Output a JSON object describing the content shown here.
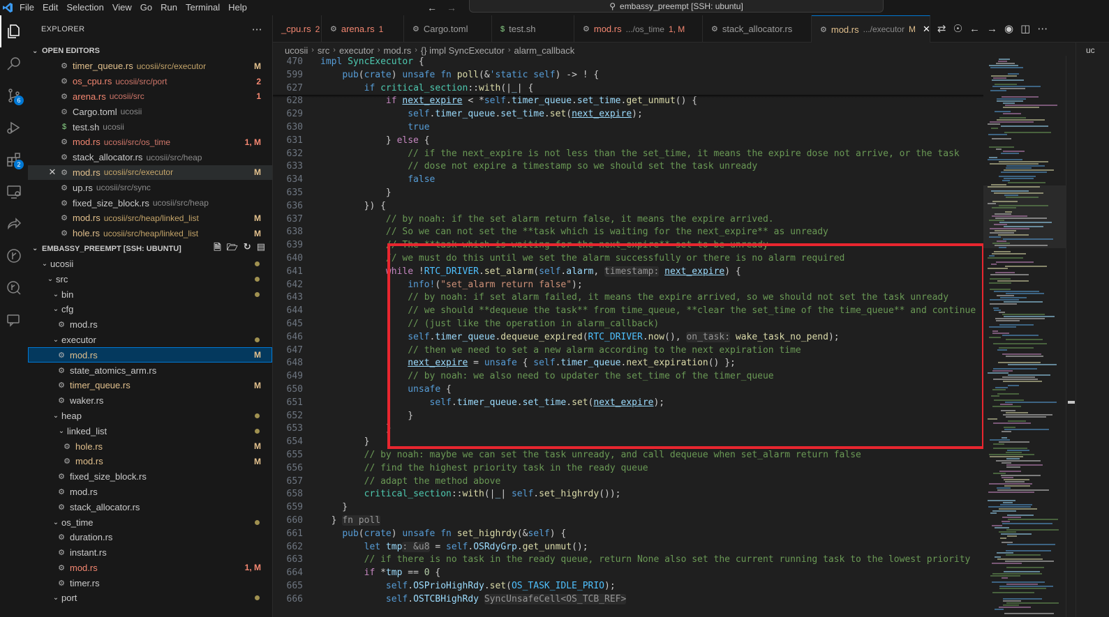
{
  "menu": [
    "File",
    "Edit",
    "Selection",
    "View",
    "Go",
    "Run",
    "Terminal",
    "Help"
  ],
  "command_center": "embassy_preempt [SSH: ubuntu]",
  "activity": {
    "scm_badge": "6",
    "extensions_badge": "2"
  },
  "explorer": {
    "title": "EXPLORER",
    "open_editors_label": "OPEN EDITORS",
    "open_editors": [
      {
        "name": "timer_queue.rs",
        "path": "ucosii/src/executor",
        "badge": "M",
        "status": "m"
      },
      {
        "name": "os_cpu.rs",
        "path": "ucosii/src/port",
        "badge": "2",
        "status": "err"
      },
      {
        "name": "arena.rs",
        "path": "ucosii/src",
        "badge": "1",
        "status": "err"
      },
      {
        "name": "Cargo.toml",
        "path": "ucosii",
        "badge": "",
        "status": ""
      },
      {
        "name": "test.sh",
        "path": "ucosii",
        "badge": "",
        "status": ""
      },
      {
        "name": "mod.rs",
        "path": "ucosii/src/os_time",
        "badge": "1, M",
        "status": "err"
      },
      {
        "name": "stack_allocator.rs",
        "path": "ucosii/src/heap",
        "badge": "",
        "status": ""
      },
      {
        "name": "mod.rs",
        "path": "ucosii/src/executor",
        "badge": "M",
        "status": "m"
      },
      {
        "name": "up.rs",
        "path": "ucosii/src/sync",
        "badge": "",
        "status": ""
      },
      {
        "name": "fixed_size_block.rs",
        "path": "ucosii/src/heap",
        "badge": "",
        "status": ""
      },
      {
        "name": "mod.rs",
        "path": "ucosii/src/heap/linked_list",
        "badge": "M",
        "status": "m"
      },
      {
        "name": "hole.rs",
        "path": "ucosii/src/heap/linked_list",
        "badge": "M",
        "status": "m"
      }
    ],
    "workspace_label": "EMBASSY_PREEMPT [SSH: UBUNTU]",
    "tree": [
      {
        "name": "ucosii",
        "type": "folder",
        "open": true,
        "depth": 0,
        "dot": true
      },
      {
        "name": "src",
        "type": "folder",
        "open": true,
        "depth": 1,
        "dot": true
      },
      {
        "name": "bin",
        "type": "folder",
        "open": true,
        "depth": 2,
        "dot": true
      },
      {
        "name": "cfg",
        "type": "folder",
        "open": true,
        "depth": 2
      },
      {
        "name": "mod.rs",
        "type": "file",
        "depth": 3
      },
      {
        "name": "executor",
        "type": "folder",
        "open": true,
        "depth": 2,
        "dot": true
      },
      {
        "name": "mod.rs",
        "type": "file",
        "depth": 3,
        "badge": "M",
        "status": "m",
        "selected": true
      },
      {
        "name": "state_atomics_arm.rs",
        "type": "file",
        "depth": 3
      },
      {
        "name": "timer_queue.rs",
        "type": "file",
        "depth": 3,
        "badge": "M",
        "status": "m"
      },
      {
        "name": "waker.rs",
        "type": "file",
        "depth": 3
      },
      {
        "name": "heap",
        "type": "folder",
        "open": true,
        "depth": 2,
        "dot": true
      },
      {
        "name": "linked_list",
        "type": "folder",
        "open": true,
        "depth": 3,
        "dot": true
      },
      {
        "name": "hole.rs",
        "type": "file",
        "depth": 4,
        "badge": "M",
        "status": "m"
      },
      {
        "name": "mod.rs",
        "type": "file",
        "depth": 4,
        "badge": "M",
        "status": "m"
      },
      {
        "name": "fixed_size_block.rs",
        "type": "file",
        "depth": 3
      },
      {
        "name": "mod.rs",
        "type": "file",
        "depth": 3
      },
      {
        "name": "stack_allocator.rs",
        "type": "file",
        "depth": 3
      },
      {
        "name": "os_time",
        "type": "folder",
        "open": true,
        "depth": 2,
        "dot": true
      },
      {
        "name": "duration.rs",
        "type": "file",
        "depth": 3
      },
      {
        "name": "instant.rs",
        "type": "file",
        "depth": 3
      },
      {
        "name": "mod.rs",
        "type": "file",
        "depth": 3,
        "badge": "1, M",
        "status": "err"
      },
      {
        "name": "timer.rs",
        "type": "file",
        "depth": 3
      },
      {
        "name": "port",
        "type": "folder",
        "open": true,
        "depth": 2,
        "dot": true
      }
    ]
  },
  "tabs": [
    {
      "label": "_cpu.rs",
      "desc": "",
      "badge": "2",
      "status": "err",
      "icon": "rust-icon"
    },
    {
      "label": "arena.rs",
      "desc": "",
      "badge": "1",
      "status": "err",
      "icon": "rust-icon"
    },
    {
      "label": "Cargo.toml",
      "desc": "",
      "badge": "",
      "status": "",
      "icon": "gear-icon"
    },
    {
      "label": "test.sh",
      "desc": "",
      "badge": "",
      "status": "",
      "icon": "dollar-icon"
    },
    {
      "label": "mod.rs",
      "desc": ".../os_time",
      "badge": "1, M",
      "status": "err",
      "icon": "rust-icon"
    },
    {
      "label": "stack_allocator.rs",
      "desc": "",
      "badge": "",
      "status": "",
      "icon": "rust-icon"
    },
    {
      "label": "mod.rs",
      "desc": ".../executor",
      "badge": "M",
      "status": "m",
      "icon": "rust-icon",
      "active": true
    }
  ],
  "breadcrumb": [
    "ucosii",
    "src",
    "executor",
    "mod.rs",
    "{} impl SyncExecutor",
    "alarm_callback"
  ],
  "right_panel_label": "uc",
  "code_lines": [
    {
      "n": "470",
      "sticky": true,
      "html": "<span class='kw'>impl</span> <span class='ty'>SyncExecutor</span> {"
    },
    {
      "n": "599",
      "sticky": true,
      "html": "    <span class='kw'>pub</span>(<span class='kw'>crate</span>) <span class='kw'>unsafe</span> <span class='kw'>fn</span> <span class='fn'>poll</span>(&amp;<span class='kw'>'static</span> <span class='kw'>self</span>) -&gt; ! {"
    },
    {
      "n": "627",
      "html": "        <span class='kw'>if</span> <span class='ty'>critical_section</span>::<span class='fn'>with</span>(|<span class='var'>_</span>| {"
    },
    {
      "n": "628",
      "html": "            <span class='ct'>if</span> <span class='var ul'>next_expire</span> &lt; *<span class='kw'>self</span>.<span class='var'>timer_queue</span>.<span class='var'>set_time</span>.<span class='fn'>get_unmut</span>() {"
    },
    {
      "n": "629",
      "html": "                <span class='kw'>self</span>.<span class='var'>timer_queue</span>.<span class='var'>set_time</span>.<span class='fn'>set</span>(<span class='var ul'>next_expire</span>);"
    },
    {
      "n": "630",
      "html": "                <span class='kw'>true</span>"
    },
    {
      "n": "631",
      "html": "            } <span class='ct'>else</span> {"
    },
    {
      "n": "632",
      "html": "                <span class='cmt'>// if the next_expire is not less than the set_time, it means the expire dose not arrive, or the task</span>"
    },
    {
      "n": "633",
      "html": "                <span class='cmt'>// dose not expire a timestamp so we should set the task unready</span>"
    },
    {
      "n": "634",
      "html": "                <span class='kw'>false</span>"
    },
    {
      "n": "635",
      "html": "            }"
    },
    {
      "n": "636",
      "html": "        }) {"
    },
    {
      "n": "637",
      "html": "            <span class='cmt'>// by noah: if the set alarm return false, it means the expire arrived.</span>"
    },
    {
      "n": "638",
      "html": "            <span class='cmt'>// So we can not set the **task which is waiting for the next_expire** as unready</span>"
    },
    {
      "n": "639",
      "html": "            <span class='cmt'>// The **task which is waiting for the next_expire** set to be unready</span>"
    },
    {
      "n": "640",
      "html": "            <span class='cmt'>// we must do this until we set the alarm successfully or there is no alarm required</span>"
    },
    {
      "n": "641",
      "html": "            <span class='ct'>while</span> !<span class='const'>RTC_DRIVER</span>.<span class='fn'>set_alarm</span>(<span class='kw'>self</span>.<span class='var'>alarm</span>, <span class='hint'>timestamp:</span> <span class='var ul'>next_expire</span>) {"
    },
    {
      "n": "642",
      "html": "                <span class='mac'>info!</span>(<span class='str'>\"set_alarm return false\"</span>);"
    },
    {
      "n": "643",
      "html": "                <span class='cmt'>// by noah: if set alarm failed, it means the expire arrived, so we should not set the task unready</span>"
    },
    {
      "n": "644",
      "html": "                <span class='cmt'>// we should **dequeue the task** from time_queue, **clear the set_time of the time_queue** and continue</span>"
    },
    {
      "n": "645",
      "html": "                <span class='cmt'>// (just like the operation in alarm_callback)</span>"
    },
    {
      "n": "646",
      "html": "                <span class='kw'>self</span>.<span class='var'>timer_queue</span>.<span class='fn'>dequeue_expired</span>(<span class='const'>RTC_DRIVER</span>.<span class='fn'>now</span>(), <span class='hint'>on_task:</span> <span class='fn'>wake_task_no_pend</span>);"
    },
    {
      "n": "647",
      "html": "                <span class='cmt'>// then we need to set a new alarm according to the next expiration time</span>"
    },
    {
      "n": "648",
      "html": "                <span class='var ul'>next_expire</span> = <span class='kw'>unsafe</span> { <span class='kw'>self</span>.<span class='var'>timer_queue</span>.<span class='fn'>next_expiration</span>() };"
    },
    {
      "n": "649",
      "html": "                <span class='cmt'>// by noah: we also need to updater the set_time of the timer_queue</span>"
    },
    {
      "n": "650",
      "html": "                <span class='kw'>unsafe</span> {"
    },
    {
      "n": "651",
      "html": "                    <span class='kw'>self</span>.<span class='var'>timer_queue</span>.<span class='var'>set_time</span>.<span class='fn'>set</span>(<span class='var ul'>next_expire</span>);"
    },
    {
      "n": "652",
      "html": "                }"
    },
    {
      "n": "653",
      "html": "            }"
    },
    {
      "n": "654",
      "html": "        }"
    },
    {
      "n": "655",
      "html": "        <span class='cmt'>// by noah: maybe we can set the task unready, and call dequeue when set_alarm return false</span>"
    },
    {
      "n": "656",
      "html": "        <span class='cmt'>// find the highest priority task in the ready queue</span>"
    },
    {
      "n": "657",
      "html": "        <span class='cmt'>// adapt the method above</span>"
    },
    {
      "n": "658",
      "html": "        <span class='ty'>critical_section</span>::<span class='fn'>with</span>(|<span class='var'>_</span>| <span class='kw'>self</span>.<span class='fn'>set_highrdy</span>());"
    },
    {
      "n": "659",
      "html": "    }"
    },
    {
      "n": "660",
      "html": "  } <span class='hint'>fn poll</span>"
    },
    {
      "n": "661",
      "html": "    <span class='kw'>pub</span>(<span class='kw'>crate</span>) <span class='kw'>unsafe</span> <span class='kw'>fn</span> <span class='fn'>set_highrdy</span>(&amp;<span class='kw'>self</span>) {"
    },
    {
      "n": "662",
      "html": "        <span class='kw'>let</span> <span class='var'>tmp</span><span class='hint'>: &amp;u8</span> = <span class='kw'>self</span>.<span class='var'>OSRdyGrp</span>.<span class='fn'>get_unmut</span>();"
    },
    {
      "n": "663",
      "html": "        <span class='cmt'>// if there is no task in the ready queue, return None also set the current running task to the lowest priority</span>"
    },
    {
      "n": "664",
      "html": "        <span class='ct'>if</span> *<span class='var'>tmp</span> == <span class='num'>0</span> {"
    },
    {
      "n": "665",
      "html": "            <span class='kw'>self</span>.<span class='var'>OSPrioHighRdy</span>.<span class='fn'>set</span>(<span class='const'>OS_TASK_IDLE_PRIO</span>);"
    },
    {
      "n": "666",
      "html": "            <span class='kw'>self</span>.<span class='var'>OSTCBHighRdy</span> <span class='hint'>SyncUnsafeCell&lt;OS_TCB_REF&gt;</span>"
    }
  ]
}
